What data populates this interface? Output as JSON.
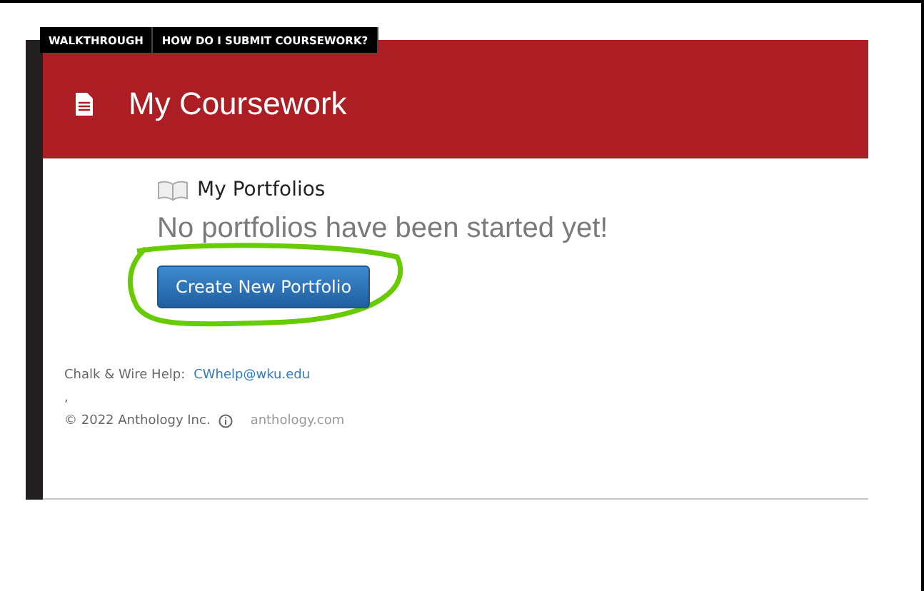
{
  "tabs": [
    {
      "label": "WALKTHROUGH"
    },
    {
      "label": "HOW DO I SUBMIT COURSEWORK?"
    }
  ],
  "header": {
    "title": "My Coursework"
  },
  "section": {
    "title": "My Portfolios",
    "message": "No portfolios have been started yet!",
    "button": "Create New Portfolio",
    "highlighted": true
  },
  "footer": {
    "help_label": "Chalk & Wire Help:",
    "help_email": "CWhelp@wku.edu",
    "stray_mark": ",",
    "copyright": "© 2022 Anthology Inc.",
    "site": "anthology.com"
  }
}
